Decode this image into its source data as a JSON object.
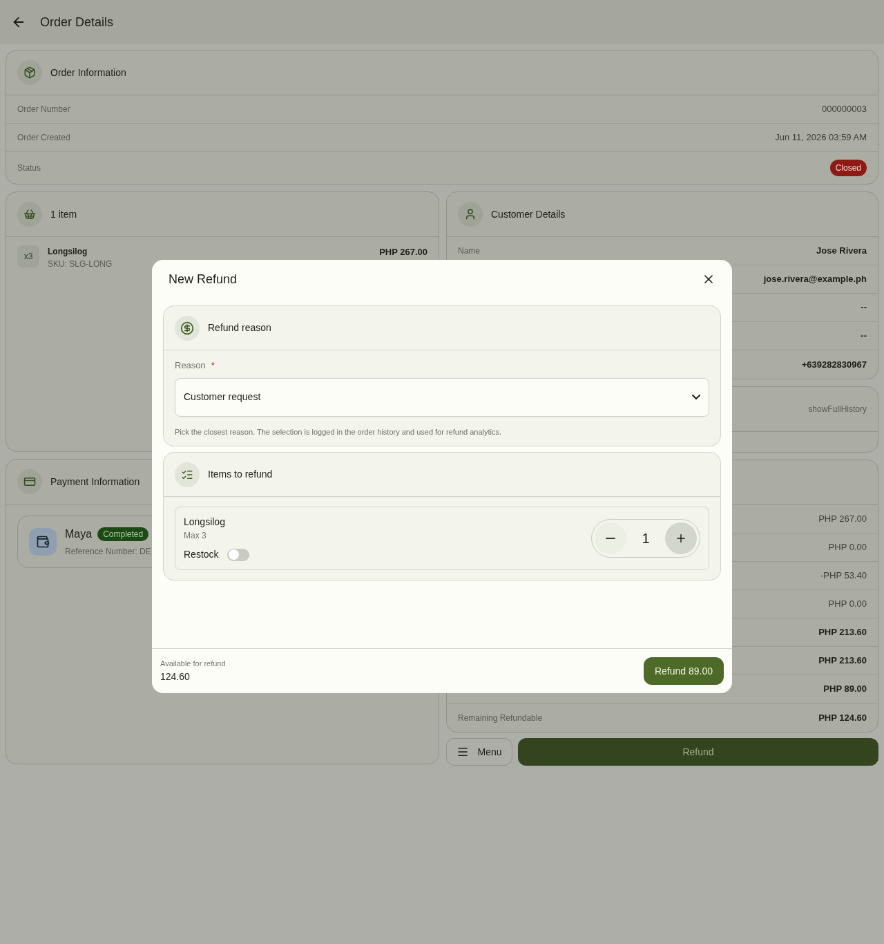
{
  "app_bar": {
    "title": "Order Details"
  },
  "order_information": {
    "title": "Order Information",
    "rows": [
      {
        "label": "Order Number",
        "value": "000000003"
      },
      {
        "label": "Order Created",
        "value": "Jun 11, 2026 03:59 AM"
      }
    ],
    "status": {
      "label": "Status",
      "value": "Closed"
    }
  },
  "items_card": {
    "title": "1 item",
    "items": [
      {
        "quantity": "x3",
        "name": "Longsilog",
        "sku": "SKU: SLG-LONG",
        "price": "PHP 267.00"
      }
    ]
  },
  "payment_card": {
    "title": "Payment Information",
    "payments": [
      {
        "method": "Maya",
        "status": "Completed",
        "reference": "Reference Number: DE"
      }
    ]
  },
  "customer_card": {
    "title": "Customer Details",
    "rows": [
      {
        "label": "Name",
        "value": "Jose Rivera"
      },
      {
        "value": "jose.rivera@example.ph"
      },
      {
        "value": "--"
      },
      {
        "value": "--"
      },
      {
        "value": "+639282830967"
      }
    ]
  },
  "history_card": {
    "link": "showFullHistory"
  },
  "summary_card": {
    "rows": [
      {
        "value": "PHP 267.00",
        "emphasis": false
      },
      {
        "value": "PHP 0.00",
        "emphasis": false
      },
      {
        "value": "-PHP 53.40",
        "emphasis": false
      },
      {
        "value": "PHP 0.00",
        "emphasis": false
      },
      {
        "value": "PHP 213.60",
        "emphasis": true
      },
      {
        "value": "PHP 213.60",
        "emphasis": true
      },
      {
        "value": "PHP 89.00",
        "emphasis": true
      }
    ],
    "total": {
      "label": "Remaining Refundable",
      "value": "PHP 124.60"
    }
  },
  "actions": {
    "menu": "Menu",
    "refund": "Refund"
  },
  "dialog": {
    "title": "New Refund",
    "reason_section": {
      "title": "Refund reason",
      "label": "Reason",
      "required_mark": "*",
      "value": "Customer request",
      "helper": "Pick the closest reason. The selection is logged in the order history and used for refund analytics."
    },
    "items_section": {
      "title": "Items to refund",
      "items": [
        {
          "name": "Longsilog",
          "max": "Max 3",
          "restock_label": "Restock",
          "restock": false,
          "quantity": "1",
          "decrease_disabled": true
        }
      ]
    },
    "footer": {
      "available_label": "Available for refund",
      "available": "124.60",
      "submit": "Refund 89.00"
    }
  }
}
